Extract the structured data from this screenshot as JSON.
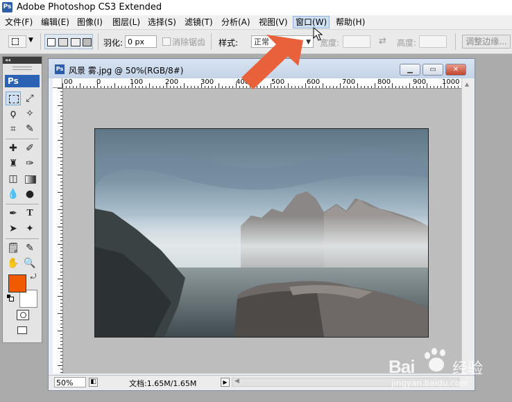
{
  "app": {
    "title": "Adobe Photoshop CS3 Extended",
    "logo": "Ps"
  },
  "menu": [
    {
      "label": "文件(F)",
      "active": false
    },
    {
      "label": "编辑(E)",
      "active": false
    },
    {
      "label": "图像(I)",
      "active": false
    },
    {
      "label": "图层(L)",
      "active": false
    },
    {
      "label": "选择(S)",
      "active": false
    },
    {
      "label": "滤镜(T)",
      "active": false
    },
    {
      "label": "分析(A)",
      "active": false
    },
    {
      "label": "视图(V)",
      "active": false
    },
    {
      "label": "窗口(W)",
      "active": true
    },
    {
      "label": "帮助(H)",
      "active": false
    }
  ],
  "options": {
    "feather_label": "羽化:",
    "feather_value": "0 px",
    "antialias_label": "消除锯齿",
    "style_label": "样式:",
    "style_value": "正常",
    "width_label": "宽度:",
    "height_label": "高度:",
    "refine_edge_label": "调整边缘..."
  },
  "tools_panel": {
    "collapse_glyph": "◂◂",
    "badge": "Ps",
    "foreground_color": "#f05a00",
    "background_color": "#ffffff"
  },
  "document": {
    "title": "风景 雾.jpg @ 50%(RGB/8#)",
    "ruler_labels": [
      "00",
      "0",
      "100",
      "200",
      "300",
      "400",
      "500",
      "600",
      "700",
      "800",
      "900",
      "1000"
    ],
    "zoom": "50%",
    "doc_info": "文档:1.65M/1.65M"
  },
  "annotation": {
    "arrow_color": "#e8613a",
    "points_to": "窗口(W)"
  },
  "watermark": {
    "brand": "Bai",
    "brand_suffix": "经验",
    "url": "jingyan.baidu.com"
  }
}
